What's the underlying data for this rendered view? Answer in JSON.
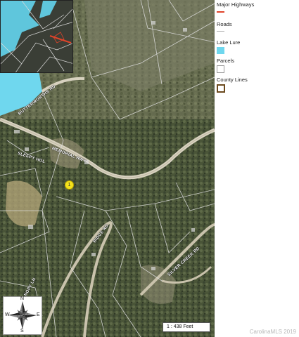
{
  "legend": {
    "major_highways": "Major Highways",
    "roads": "Roads",
    "lake_lure": "Lake Lure",
    "parcels": "Parcels",
    "county_lines": "County Lines"
  },
  "colors": {
    "highway": "#e0442a",
    "roads": "#b0b0b0",
    "lake": "#6fd7ee",
    "parcel_border": "#9a9a9a",
    "county_line": "#6b4a1e",
    "marker": "#f4e21c"
  },
  "road_labels": {
    "tryon_bay_cir": "BUTTERWORTHS RD",
    "sleepy_hollow": "SLEEPY HOL",
    "memorial_hwy": "MEMORIAL HWY",
    "ridge_rd": "RIDGE RD",
    "silver_creek_rd": "SILVER CREEK RD",
    "lower_rd": "CANOPY LN"
  },
  "marker_label": "1",
  "compass": {
    "north": "N",
    "south": "S",
    "east": "E",
    "west": "W"
  },
  "scale_text": "1 : 438 Feet",
  "credit": "CarolinaMLS 2019"
}
